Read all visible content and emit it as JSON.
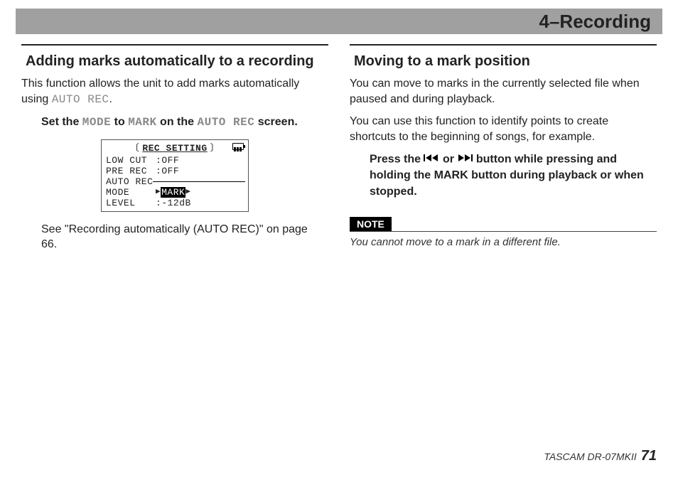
{
  "header": {
    "chapter": "4–Recording"
  },
  "left": {
    "title": "Adding marks automatically to a recording",
    "intro_pre": "This function allows the unit to add marks automatically using ",
    "intro_mono": "AUTO REC",
    "intro_post": ".",
    "instr_pre": "Set the ",
    "instr_mode": "MODE",
    "instr_mid1": " to ",
    "instr_mark": "MARK",
    "instr_mid2": " on the ",
    "instr_auto": "AUTO REC",
    "instr_post": " screen.",
    "see_ref": "See \"Recording automatically (AUTO REC)\" on page 66."
  },
  "lcd": {
    "title": "REC SETTING",
    "rows": [
      {
        "label": "LOW CUT",
        "value": "OFF"
      },
      {
        "label": "PRE REC",
        "value": "OFF"
      }
    ],
    "divider_label": "AUTO REC",
    "sel_label": "MODE",
    "sel_value": "MARK",
    "after_label": "LEVEL",
    "after_value": "-12dB"
  },
  "right": {
    "title": "Moving to a mark position",
    "p1": "You can move to marks in the currently selected file when paused and during playback.",
    "p2": "You can use this function to identify points to create shortcuts to the beginning of songs, for example.",
    "instr_pre": "Press the ",
    "instr_or": " or ",
    "instr_post": " button while pressing and holding the MARK button during playback or when stopped.",
    "note_label": "NOTE",
    "note_text": "You cannot move to a mark in a different file."
  },
  "footer": {
    "product": "TASCAM DR-07MKII",
    "page": "71"
  },
  "icons": {
    "prev": "skip-back-icon",
    "next": "skip-forward-icon"
  }
}
